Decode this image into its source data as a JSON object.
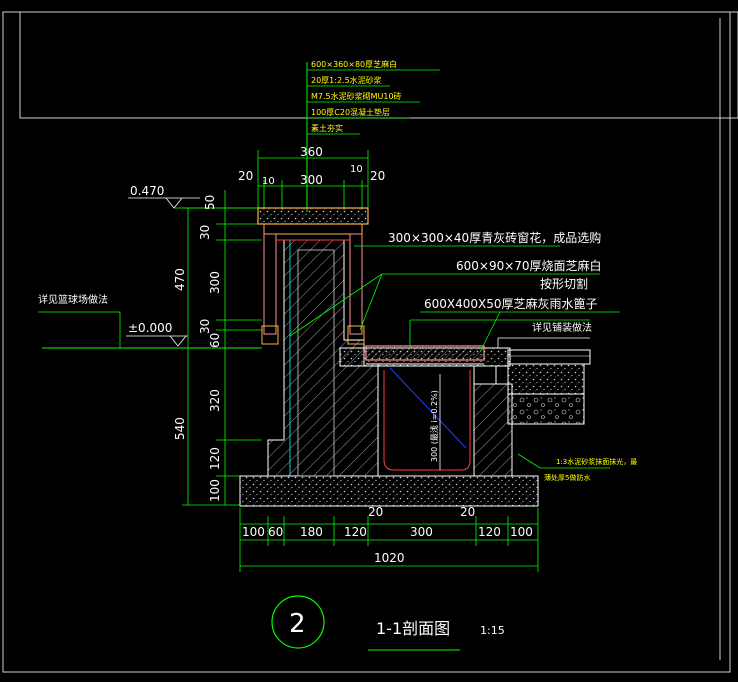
{
  "colors": {
    "background": "#000000",
    "white": "#ffffff",
    "green": "#00ff00",
    "yellow": "#ffff00",
    "red": "#ff3b3b",
    "cyan": "#00ffff",
    "blue": "#2040ff",
    "magenta": "#ff40ff",
    "pink": "#ff9090",
    "orange": "#ffb040",
    "gray": "#bfbfbf"
  },
  "layer_notes": [
    "600×360×80厚芝麻白",
    "20厚1:2.5水泥砂浆",
    "M7.5水泥砂浆砌MU10砖",
    "100厚C20混凝土垫层",
    "素土夯实"
  ],
  "callouts": {
    "window": "300×300×40厚青灰砖窗花，成品选购",
    "cap": "600×90×70厚烧面芝麻白",
    "cap_2": "按形切割",
    "cover": "600X400X50厚芝麻灰雨水篦子",
    "paving": "详见铺装做法",
    "lawn": "详见篮球场做法",
    "mortar": "1:3水泥砂浆抹面抹光，最",
    "mortar_2": "薄处厚5做防水"
  },
  "elevations": {
    "top": "0.470",
    "ground": "±0.000"
  },
  "dims_top": {
    "overall": "360",
    "left_20": "20",
    "left_10": "10",
    "inner": "300",
    "right_10": "10",
    "right_20": "20"
  },
  "dims_left": [
    "50",
    "30",
    "470",
    "300",
    "30",
    "60",
    "320",
    "540",
    "120",
    "100"
  ],
  "dims_bottom": [
    "100",
    "60",
    "180",
    "120",
    "300",
    "120",
    "100"
  ],
  "dims_misc": {
    "gap_a": "20",
    "gap_b": "20",
    "total": "1020",
    "channel_depth": "300 (最浅 i=0.2%)"
  },
  "title": {
    "number": "2",
    "name": "1-1剖面图",
    "scale": "1:15"
  }
}
